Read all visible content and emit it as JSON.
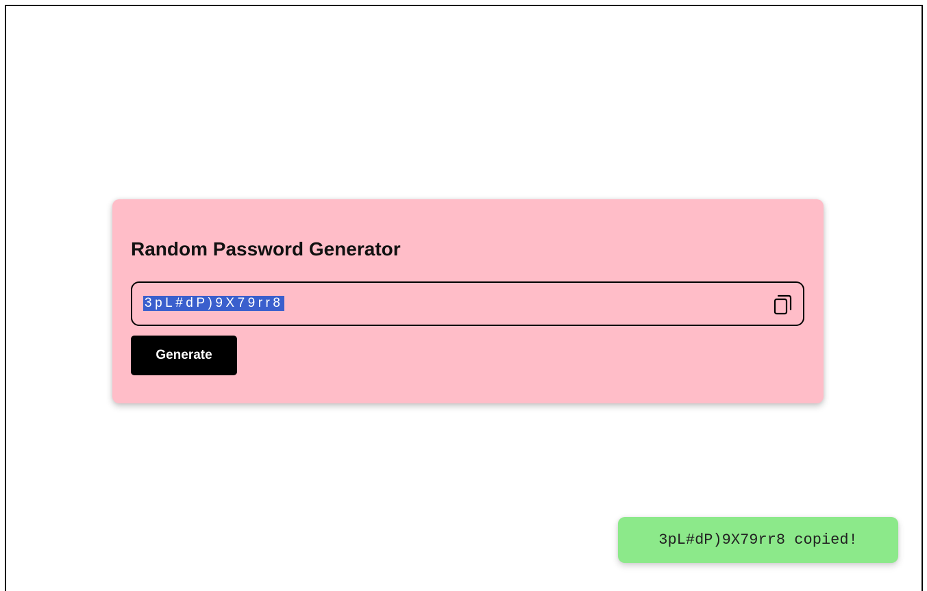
{
  "app": {
    "title": "Random Password Generator"
  },
  "password": {
    "value": "3pL#dP)9X79rr8",
    "selected": true,
    "selection_color": "#3a5fcd"
  },
  "actions": {
    "copy_icon": "copy-icon",
    "generate_label": "Generate"
  },
  "toast": {
    "password": "3pL#dP)9X79rr8",
    "suffix": " copied!",
    "color": "#8ce98a"
  },
  "colors": {
    "card_background": "#ffbdc8",
    "button_background": "#000000"
  }
}
